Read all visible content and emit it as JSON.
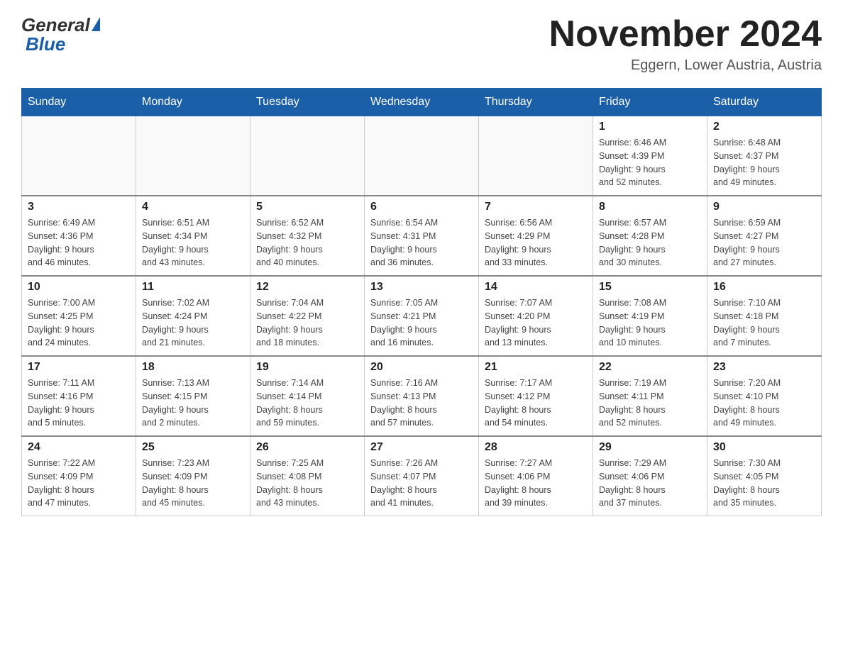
{
  "logo": {
    "general": "General",
    "blue": "Blue"
  },
  "title": "November 2024",
  "location": "Eggern, Lower Austria, Austria",
  "weekdays": [
    "Sunday",
    "Monday",
    "Tuesday",
    "Wednesday",
    "Thursday",
    "Friday",
    "Saturday"
  ],
  "weeks": [
    [
      {
        "day": "",
        "info": ""
      },
      {
        "day": "",
        "info": ""
      },
      {
        "day": "",
        "info": ""
      },
      {
        "day": "",
        "info": ""
      },
      {
        "day": "",
        "info": ""
      },
      {
        "day": "1",
        "info": "Sunrise: 6:46 AM\nSunset: 4:39 PM\nDaylight: 9 hours\nand 52 minutes."
      },
      {
        "day": "2",
        "info": "Sunrise: 6:48 AM\nSunset: 4:37 PM\nDaylight: 9 hours\nand 49 minutes."
      }
    ],
    [
      {
        "day": "3",
        "info": "Sunrise: 6:49 AM\nSunset: 4:36 PM\nDaylight: 9 hours\nand 46 minutes."
      },
      {
        "day": "4",
        "info": "Sunrise: 6:51 AM\nSunset: 4:34 PM\nDaylight: 9 hours\nand 43 minutes."
      },
      {
        "day": "5",
        "info": "Sunrise: 6:52 AM\nSunset: 4:32 PM\nDaylight: 9 hours\nand 40 minutes."
      },
      {
        "day": "6",
        "info": "Sunrise: 6:54 AM\nSunset: 4:31 PM\nDaylight: 9 hours\nand 36 minutes."
      },
      {
        "day": "7",
        "info": "Sunrise: 6:56 AM\nSunset: 4:29 PM\nDaylight: 9 hours\nand 33 minutes."
      },
      {
        "day": "8",
        "info": "Sunrise: 6:57 AM\nSunset: 4:28 PM\nDaylight: 9 hours\nand 30 minutes."
      },
      {
        "day": "9",
        "info": "Sunrise: 6:59 AM\nSunset: 4:27 PM\nDaylight: 9 hours\nand 27 minutes."
      }
    ],
    [
      {
        "day": "10",
        "info": "Sunrise: 7:00 AM\nSunset: 4:25 PM\nDaylight: 9 hours\nand 24 minutes."
      },
      {
        "day": "11",
        "info": "Sunrise: 7:02 AM\nSunset: 4:24 PM\nDaylight: 9 hours\nand 21 minutes."
      },
      {
        "day": "12",
        "info": "Sunrise: 7:04 AM\nSunset: 4:22 PM\nDaylight: 9 hours\nand 18 minutes."
      },
      {
        "day": "13",
        "info": "Sunrise: 7:05 AM\nSunset: 4:21 PM\nDaylight: 9 hours\nand 16 minutes."
      },
      {
        "day": "14",
        "info": "Sunrise: 7:07 AM\nSunset: 4:20 PM\nDaylight: 9 hours\nand 13 minutes."
      },
      {
        "day": "15",
        "info": "Sunrise: 7:08 AM\nSunset: 4:19 PM\nDaylight: 9 hours\nand 10 minutes."
      },
      {
        "day": "16",
        "info": "Sunrise: 7:10 AM\nSunset: 4:18 PM\nDaylight: 9 hours\nand 7 minutes."
      }
    ],
    [
      {
        "day": "17",
        "info": "Sunrise: 7:11 AM\nSunset: 4:16 PM\nDaylight: 9 hours\nand 5 minutes."
      },
      {
        "day": "18",
        "info": "Sunrise: 7:13 AM\nSunset: 4:15 PM\nDaylight: 9 hours\nand 2 minutes."
      },
      {
        "day": "19",
        "info": "Sunrise: 7:14 AM\nSunset: 4:14 PM\nDaylight: 8 hours\nand 59 minutes."
      },
      {
        "day": "20",
        "info": "Sunrise: 7:16 AM\nSunset: 4:13 PM\nDaylight: 8 hours\nand 57 minutes."
      },
      {
        "day": "21",
        "info": "Sunrise: 7:17 AM\nSunset: 4:12 PM\nDaylight: 8 hours\nand 54 minutes."
      },
      {
        "day": "22",
        "info": "Sunrise: 7:19 AM\nSunset: 4:11 PM\nDaylight: 8 hours\nand 52 minutes."
      },
      {
        "day": "23",
        "info": "Sunrise: 7:20 AM\nSunset: 4:10 PM\nDaylight: 8 hours\nand 49 minutes."
      }
    ],
    [
      {
        "day": "24",
        "info": "Sunrise: 7:22 AM\nSunset: 4:09 PM\nDaylight: 8 hours\nand 47 minutes."
      },
      {
        "day": "25",
        "info": "Sunrise: 7:23 AM\nSunset: 4:09 PM\nDaylight: 8 hours\nand 45 minutes."
      },
      {
        "day": "26",
        "info": "Sunrise: 7:25 AM\nSunset: 4:08 PM\nDaylight: 8 hours\nand 43 minutes."
      },
      {
        "day": "27",
        "info": "Sunrise: 7:26 AM\nSunset: 4:07 PM\nDaylight: 8 hours\nand 41 minutes."
      },
      {
        "day": "28",
        "info": "Sunrise: 7:27 AM\nSunset: 4:06 PM\nDaylight: 8 hours\nand 39 minutes."
      },
      {
        "day": "29",
        "info": "Sunrise: 7:29 AM\nSunset: 4:06 PM\nDaylight: 8 hours\nand 37 minutes."
      },
      {
        "day": "30",
        "info": "Sunrise: 7:30 AM\nSunset: 4:05 PM\nDaylight: 8 hours\nand 35 minutes."
      }
    ]
  ]
}
